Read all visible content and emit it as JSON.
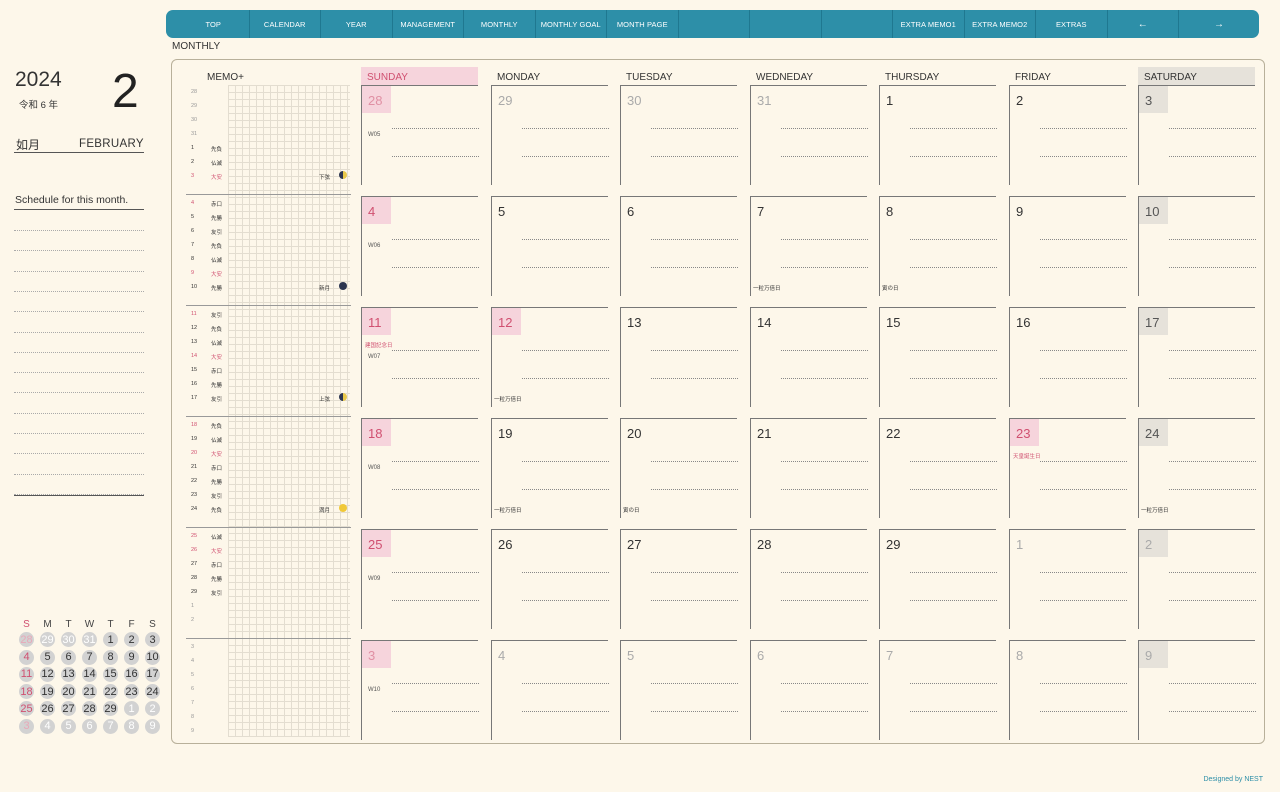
{
  "nav": {
    "items": [
      "TOP",
      "CALENDAR",
      "YEAR",
      "MANAGEMENT",
      "MONTHLY",
      "MONTHLY GOAL",
      "MONTH PAGE",
      "",
      "",
      "",
      "EXTRA MEMO1",
      "EXTRA MEMO2",
      "EXTRAS",
      "←",
      "→"
    ]
  },
  "section_label": "MONTHLY",
  "header": {
    "year": "2024",
    "wareki": "令和 6 年",
    "month_num": "2",
    "jp_month": "如月",
    "en_month": "FEBRUARY",
    "schedule_title": "Schedule for this month."
  },
  "mini_calendar": {
    "weekdays": [
      "S",
      "M",
      "T",
      "W",
      "T",
      "F",
      "S"
    ],
    "weeks": [
      [
        "28",
        "29",
        "30",
        "31",
        "1",
        "2",
        "3"
      ],
      [
        "4",
        "5",
        "6",
        "7",
        "8",
        "9",
        "10"
      ],
      [
        "11",
        "12",
        "13",
        "14",
        "15",
        "16",
        "17"
      ],
      [
        "18",
        "19",
        "20",
        "21",
        "22",
        "23",
        "24"
      ],
      [
        "25",
        "26",
        "27",
        "28",
        "29",
        "1",
        "2"
      ],
      [
        "3",
        "4",
        "5",
        "6",
        "7",
        "8",
        "9"
      ]
    ]
  },
  "memo": {
    "title": "MEMO+",
    "blocks": [
      [
        [
          "28",
          ""
        ],
        [
          "29",
          ""
        ],
        [
          "30",
          ""
        ],
        [
          "31",
          ""
        ],
        [
          "1",
          "先負"
        ],
        [
          "2",
          "仏滅"
        ],
        [
          "3",
          "大安",
          "下弦"
        ]
      ],
      [
        [
          "4",
          "赤口"
        ],
        [
          "5",
          "先勝"
        ],
        [
          "6",
          "友引"
        ],
        [
          "7",
          "先負"
        ],
        [
          "8",
          "仏滅"
        ],
        [
          "9",
          "大安"
        ],
        [
          "10",
          "先勝",
          "新月"
        ]
      ],
      [
        [
          "11",
          "友引"
        ],
        [
          "12",
          "先負"
        ],
        [
          "13",
          "仏滅"
        ],
        [
          "14",
          "大安"
        ],
        [
          "15",
          "赤口"
        ],
        [
          "16",
          "先勝"
        ],
        [
          "17",
          "友引",
          "上弦"
        ]
      ],
      [
        [
          "18",
          "先負"
        ],
        [
          "19",
          "仏滅"
        ],
        [
          "20",
          "大安"
        ],
        [
          "21",
          "赤口"
        ],
        [
          "22",
          "先勝"
        ],
        [
          "23",
          "友引"
        ],
        [
          "24",
          "先負",
          "満月"
        ]
      ],
      [
        [
          "25",
          "仏滅"
        ],
        [
          "26",
          "大安"
        ],
        [
          "27",
          "赤口"
        ],
        [
          "28",
          "先勝"
        ],
        [
          "29",
          "友引"
        ],
        [
          "1",
          ""
        ],
        [
          "2",
          ""
        ]
      ],
      [
        [
          "3",
          ""
        ],
        [
          "4",
          ""
        ],
        [
          "5",
          ""
        ],
        [
          "6",
          ""
        ],
        [
          "7",
          ""
        ],
        [
          "8",
          ""
        ],
        [
          "9",
          ""
        ]
      ]
    ]
  },
  "calendar": {
    "weekdays": [
      "SUNDAY",
      "MONDAY",
      "TUESDAY",
      "WEDNEDAY",
      "THURSDAY",
      "FRIDAY",
      "SATURDAY"
    ],
    "weeks": [
      {
        "week": "W05",
        "days": [
          "28",
          "29",
          "30",
          "31",
          "1",
          "2",
          "3"
        ]
      },
      {
        "week": "W06",
        "days": [
          "4",
          "5",
          "6",
          "7",
          "8",
          "9",
          "10"
        ]
      },
      {
        "week": "W07",
        "days": [
          "11",
          "12",
          "13",
          "14",
          "15",
          "16",
          "17"
        ]
      },
      {
        "week": "W08",
        "days": [
          "18",
          "19",
          "20",
          "21",
          "22",
          "23",
          "24"
        ]
      },
      {
        "week": "W09",
        "days": [
          "25",
          "26",
          "27",
          "28",
          "29",
          "1",
          "2"
        ]
      },
      {
        "week": "W10",
        "days": [
          "3",
          "4",
          "5",
          "6",
          "7",
          "8",
          "9"
        ]
      }
    ],
    "holidays": {
      "feb11": "建国記念日",
      "feb23": "天皇誕生日"
    },
    "notes": {
      "feb7": "一粒万倍日",
      "feb8": "寅の日",
      "feb12": "一粒万倍日",
      "feb19": "一粒万倍日",
      "feb20": "寅の日",
      "feb24": "一粒万倍日"
    }
  },
  "credit": "Designed by NEST"
}
